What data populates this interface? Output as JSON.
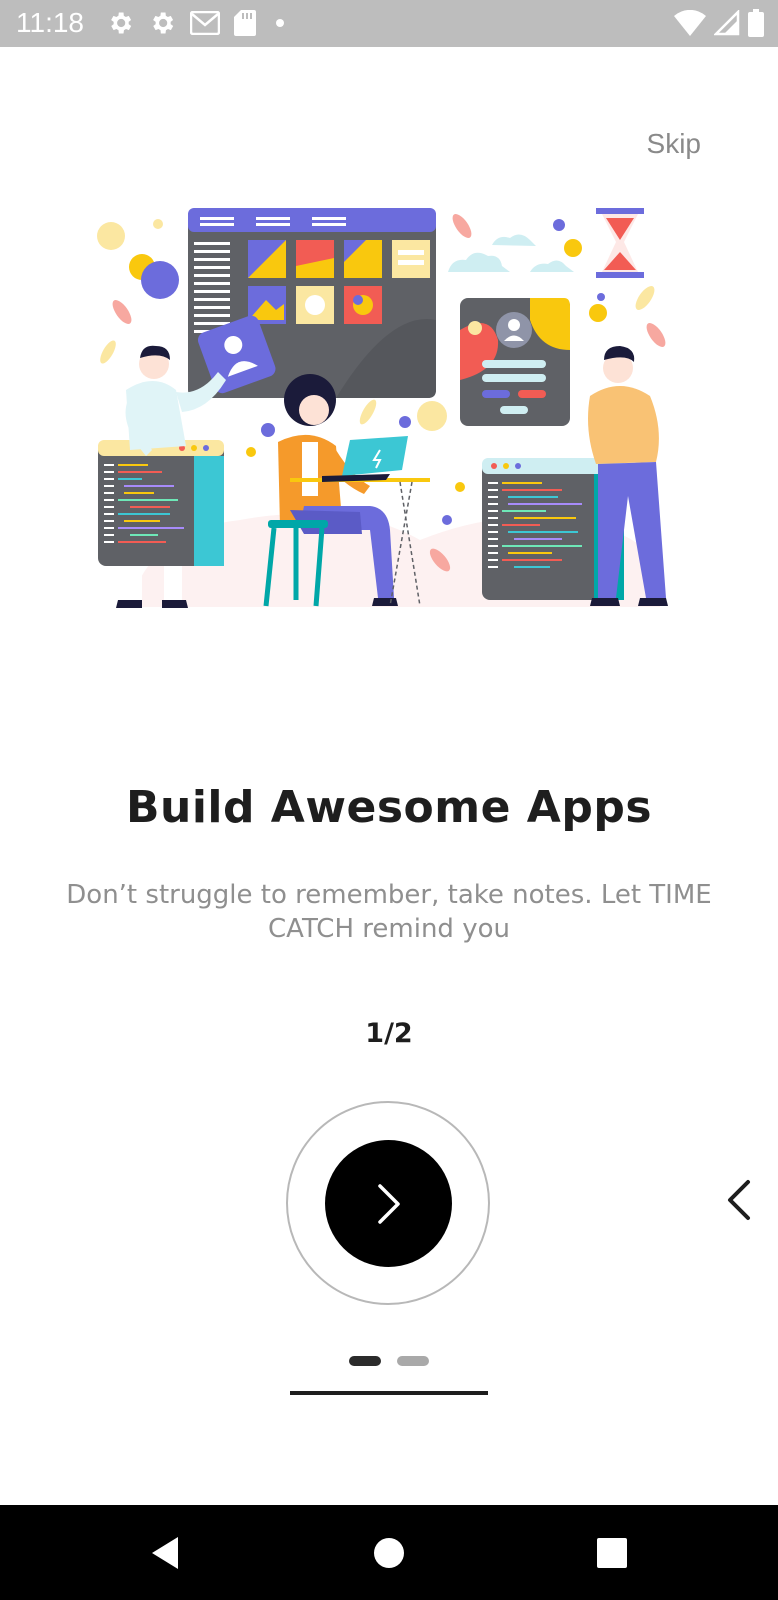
{
  "status_bar": {
    "time": "11:18",
    "left_icons": [
      "settings-icon",
      "settings-icon",
      "gmail-icon",
      "sd-card-icon",
      "dot-icon"
    ],
    "right_icons": [
      "wifi-icon",
      "cellular-signal-icon",
      "battery-icon"
    ]
  },
  "onboarding": {
    "skip_label": "Skip",
    "illustration": "team-building-apps-illustration",
    "title": "Build Awesome Apps",
    "subtitle": "Don’t struggle to remember, take notes. Let TIME CATCH remind you",
    "page_counter": "1/2",
    "current_page": 1,
    "total_pages": 2
  },
  "colors": {
    "accent": "#000000",
    "primary_text": "#1e1e1e",
    "secondary_text": "#8f8f8f",
    "status_bar": "#bdbdbd",
    "illustration_purple": "#6c6cdc",
    "illustration_orange": "#f59a2b",
    "illustration_yellow": "#f9c80e",
    "illustration_red": "#f25c54",
    "illustration_teal": "#3cc7d4"
  },
  "nav_bar": {
    "buttons": [
      "back-icon",
      "home-icon",
      "recents-icon"
    ]
  }
}
